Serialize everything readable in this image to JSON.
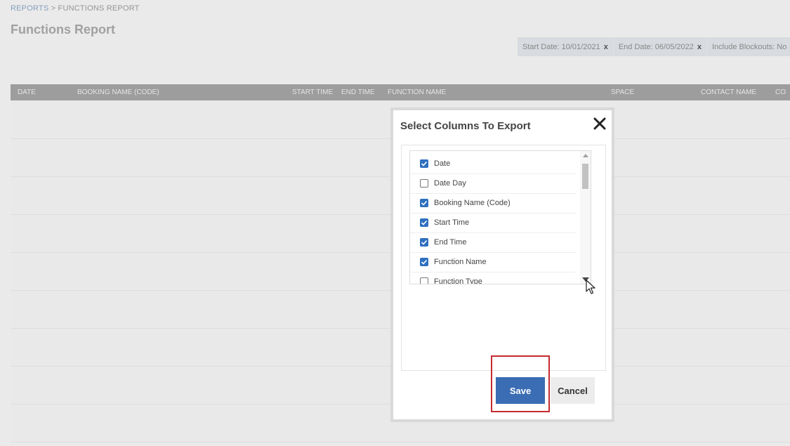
{
  "breadcrumb": {
    "root": "REPORTS",
    "separator": ">",
    "current": "FUNCTIONS REPORT"
  },
  "page_title": "Functions Report",
  "filters": [
    {
      "label": "Start Date: 10/01/2021",
      "remove": "x"
    },
    {
      "label": "End Date: 06/05/2022",
      "remove": "x"
    },
    {
      "label": "Include Blockouts: No",
      "remove": "x"
    }
  ],
  "table": {
    "columns": [
      "DATE",
      "BOOKING NAME (CODE)",
      "START TIME",
      "END TIME",
      "FUNCTION NAME",
      "SPACE",
      "CONTACT NAME",
      "CO"
    ]
  },
  "modal": {
    "title": "Select Columns To Export",
    "columns": [
      {
        "label": "Date",
        "checked": true
      },
      {
        "label": "Date Day",
        "checked": false
      },
      {
        "label": "Booking Name (Code)",
        "checked": true
      },
      {
        "label": "Start Time",
        "checked": true
      },
      {
        "label": "End Time",
        "checked": true
      },
      {
        "label": "Function Name",
        "checked": true
      },
      {
        "label": "Function Type",
        "checked": false
      }
    ],
    "save_label": "Save",
    "cancel_label": "Cancel"
  },
  "colors": {
    "accent": "#3a6db4",
    "highlight": "#c62a2f",
    "header": "#a3a3a3"
  }
}
